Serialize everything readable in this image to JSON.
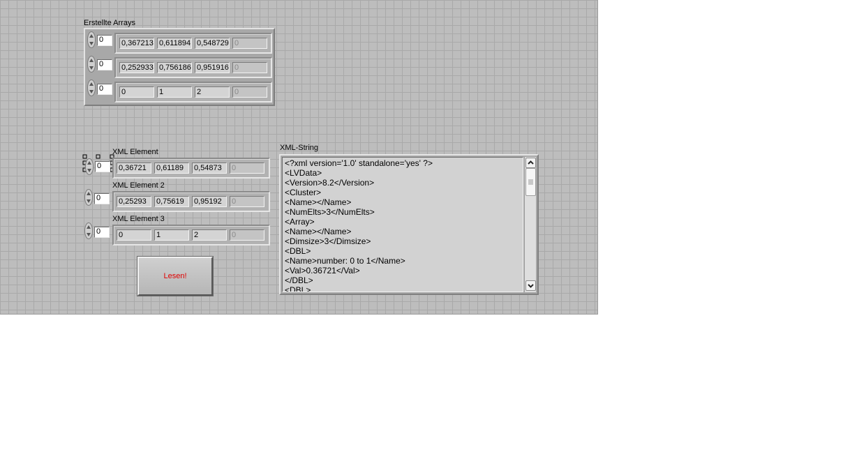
{
  "arrays_group": {
    "label": "Erstellte Arrays",
    "rows": [
      {
        "index": "0",
        "cells": [
          "0,367213",
          "0,611894",
          "0,548729",
          "0"
        ]
      },
      {
        "index": "0",
        "cells": [
          "0,252933",
          "0,756186",
          "0,951916",
          "0"
        ]
      },
      {
        "index": "0",
        "cells": [
          "0",
          "1",
          "2",
          "0"
        ]
      }
    ]
  },
  "xml_elements": [
    {
      "label": "XML Element",
      "index": "0",
      "cells": [
        "0,36721",
        "0,61189",
        "0,54873",
        "0"
      ]
    },
    {
      "label": "XML Element 2",
      "index": "0",
      "cells": [
        "0,25293",
        "0,75619",
        "0,95192",
        "0"
      ]
    },
    {
      "label": "XML Element 3",
      "index": "0",
      "cells": [
        "0",
        "1",
        "2",
        "0"
      ]
    }
  ],
  "read_button": {
    "label": "Lesen!"
  },
  "xml_string": {
    "label": "XML-String",
    "lines": [
      "<?xml version='1.0' standalone='yes' ?>",
      "<LVData>",
      "<Version>8.2</Version>",
      "<Cluster>",
      "<Name></Name>",
      "<NumElts>3</NumElts>",
      "<Array>",
      "<Name></Name>",
      "<Dimsize>3</Dimsize>",
      "<DBL>",
      "<Name>number: 0 to 1</Name>",
      "<Val>0.36721</Val>",
      "</DBL>",
      "<DBL>"
    ]
  },
  "colors": {
    "panel": "#bdbdbd",
    "grid": "#a9a9a9",
    "button_text": "#e00000"
  }
}
